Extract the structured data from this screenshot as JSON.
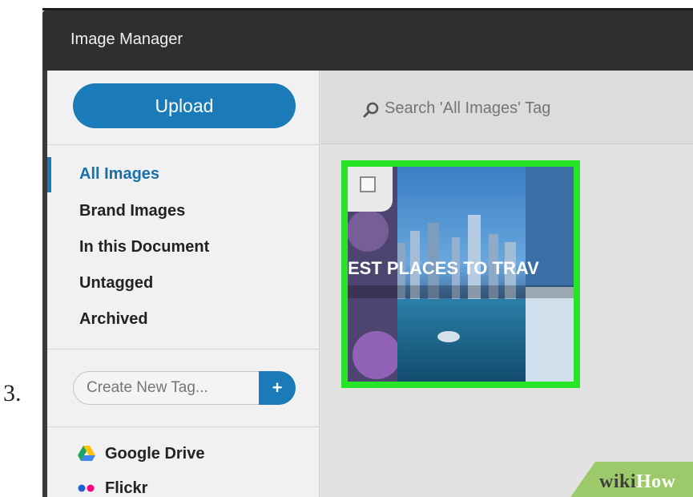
{
  "step_number": "3.",
  "window": {
    "title": "Image Manager"
  },
  "sidebar": {
    "upload_label": "Upload",
    "nav_items": [
      {
        "label": "All Images",
        "active": true
      },
      {
        "label": "Brand Images",
        "active": false
      },
      {
        "label": "In this Document",
        "active": false
      },
      {
        "label": "Untagged",
        "active": false
      },
      {
        "label": "Archived",
        "active": false
      }
    ],
    "new_tag": {
      "placeholder": "Create New Tag...",
      "add_label": "+"
    },
    "sources": [
      {
        "label": "Google Drive",
        "icon": "google-drive-icon"
      },
      {
        "label": "Flickr",
        "icon": "flickr-icon"
      }
    ]
  },
  "main": {
    "search_placeholder": "Search 'All Images' Tag",
    "thumbnail": {
      "caption_text": "EST PLACES TO TRAV",
      "selected": true,
      "highlight_color": "#26e526"
    }
  },
  "watermark": {
    "wiki": "wiki",
    "how": "How"
  },
  "colors": {
    "accent": "#1b7ab8",
    "titlebar": "#2f2f2f"
  }
}
